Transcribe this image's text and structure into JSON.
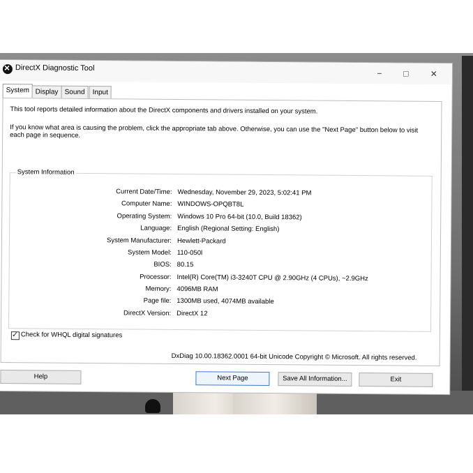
{
  "window": {
    "title": "DirectX Diagnostic Tool",
    "minimize_glyph": "−",
    "maximize_glyph": "□",
    "close_glyph": "✕"
  },
  "tabs": [
    {
      "label": "System"
    },
    {
      "label": "Display"
    },
    {
      "label": "Sound"
    },
    {
      "label": "Input"
    }
  ],
  "intro": {
    "line1": "This tool reports detailed information about the DirectX components and drivers installed on your system.",
    "line2": "If you know what area is causing the problem, click the appropriate tab above.  Otherwise, you can use the \"Next Page\" button below to visit each page in sequence."
  },
  "system_info": {
    "group_label": "System Information",
    "rows": [
      {
        "key": "Current Date/Time:",
        "value": "Wednesday, November 29, 2023, 5:02:41 PM"
      },
      {
        "key": "Computer Name:",
        "value": "WINDOWS-OPQBT8L"
      },
      {
        "key": "Operating System:",
        "value": "Windows 10 Pro 64-bit (10.0, Build 18362)"
      },
      {
        "key": "Language:",
        "value": "English (Regional Setting: English)"
      },
      {
        "key": "System Manufacturer:",
        "value": "Hewlett-Packard"
      },
      {
        "key": "System Model:",
        "value": "110-050l"
      },
      {
        "key": "BIOS:",
        "value": "80.15"
      },
      {
        "key": "Processor:",
        "value": "Intel(R) Core(TM) i3-3240T CPU @ 2.90GHz (4 CPUs), ~2.9GHz"
      },
      {
        "key": "Memory:",
        "value": "4096MB RAM"
      },
      {
        "key": "Page file:",
        "value": "1300MB used, 4074MB available"
      },
      {
        "key": "DirectX Version:",
        "value": "DirectX 12"
      }
    ]
  },
  "whql_checkbox": {
    "label": "Check for WHQL digital signatures",
    "checked": true
  },
  "copyright": "DxDiag 10.00.18362.0001 64-bit Unicode  Copyright © Microsoft. All rights reserved.",
  "buttons": {
    "help": "Help",
    "next_page": "Next Page",
    "save_all": "Save All Information...",
    "exit": "Exit"
  },
  "colors": {
    "accent_focus": "#3b7bd6",
    "window_bg": "#ffffff",
    "button_bg": "#e9e9e9"
  }
}
